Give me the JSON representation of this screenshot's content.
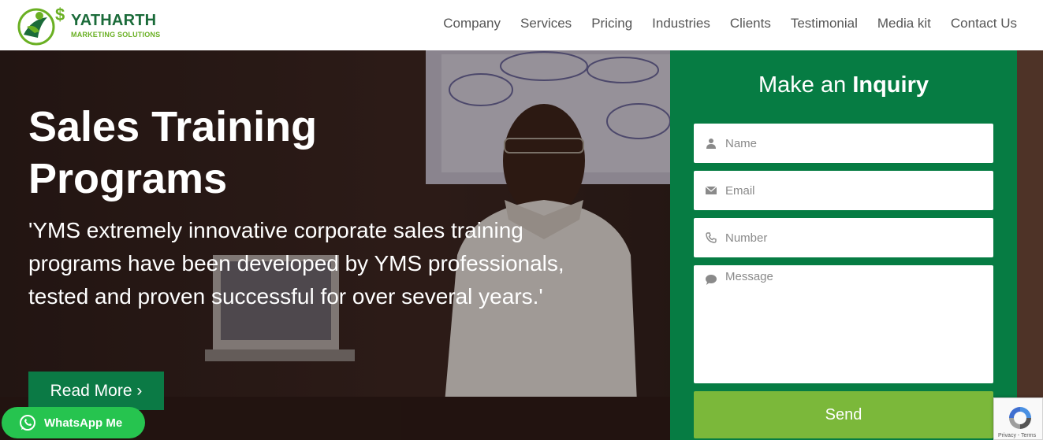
{
  "header": {
    "logo": {
      "name": "YATHARTH",
      "subtitle": "MARKETING SOLUTIONS"
    },
    "nav": [
      {
        "label": "Company"
      },
      {
        "label": "Services"
      },
      {
        "label": "Pricing"
      },
      {
        "label": "Industries"
      },
      {
        "label": "Clients"
      },
      {
        "label": "Testimonial"
      },
      {
        "label": "Media kit"
      },
      {
        "label": "Contact Us"
      }
    ]
  },
  "hero": {
    "title": "Sales Training Programs",
    "description": "'YMS extremely innovative corporate sales training programs have been developed by YMS professionals, tested and proven successful for over several years.'",
    "read_more_label": "Read More ›"
  },
  "inquiry": {
    "title_prefix": "Make an",
    "title_bold": "Inquiry",
    "name_placeholder": "Name",
    "email_placeholder": "Email",
    "number_placeholder": "Number",
    "message_placeholder": "Message",
    "send_label": "Send"
  },
  "whatsapp": {
    "label": "WhatsApp Me"
  },
  "recaptcha": {
    "links": "Privacy - Terms"
  },
  "colors": {
    "brand_green": "#067c43",
    "button_green": "#0b7a45",
    "send_green": "#7bb83a",
    "whatsapp_green": "#26c44f",
    "logo_dark_green": "#1b6b3a",
    "logo_light_green": "#6ab023"
  }
}
